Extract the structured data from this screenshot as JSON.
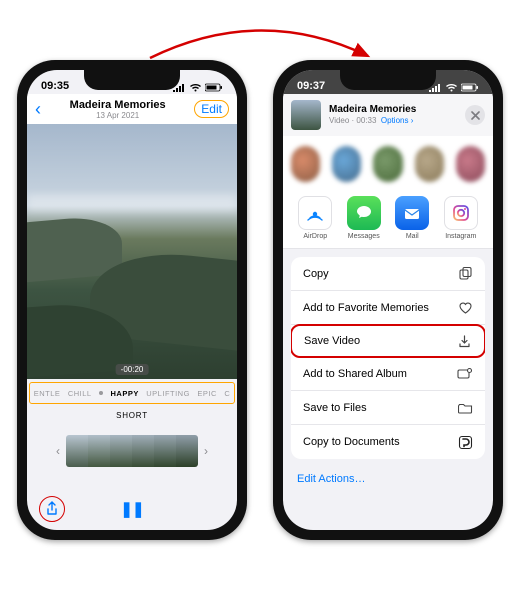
{
  "arrow_color": "#d40000",
  "phone1": {
    "status_time": "09:35",
    "title": "Madeira Memories",
    "subtitle": "13 Apr 2021",
    "edit_label": "Edit",
    "elapsed": "-00:20",
    "moods": [
      "ENTLE",
      "CHILL",
      "HAPPY",
      "UPLIFTING",
      "EPIC",
      "C"
    ],
    "selected_mood_index": 2,
    "length_label": "SHORT",
    "pause_glyph": "❚❚"
  },
  "phone2": {
    "status_time": "09:37",
    "sheet_title": "Madeira Memories",
    "sheet_sub_prefix": "Video · 00:33",
    "sheet_sub_options": "Options",
    "apps": [
      {
        "label": "AirDrop"
      },
      {
        "label": "Messages"
      },
      {
        "label": "Mail"
      },
      {
        "label": "Instagram"
      }
    ],
    "actions": [
      {
        "label": "Copy",
        "icon": "copy"
      },
      {
        "label": "Add to Favorite Memories",
        "icon": "heart"
      },
      {
        "label": "Save Video",
        "icon": "download",
        "highlight": true
      },
      {
        "label": "Add to Shared Album",
        "icon": "shared-album"
      },
      {
        "label": "Save to Files",
        "icon": "folder"
      },
      {
        "label": "Copy to Documents",
        "icon": "documents"
      }
    ],
    "edit_actions_label": "Edit Actions…"
  }
}
